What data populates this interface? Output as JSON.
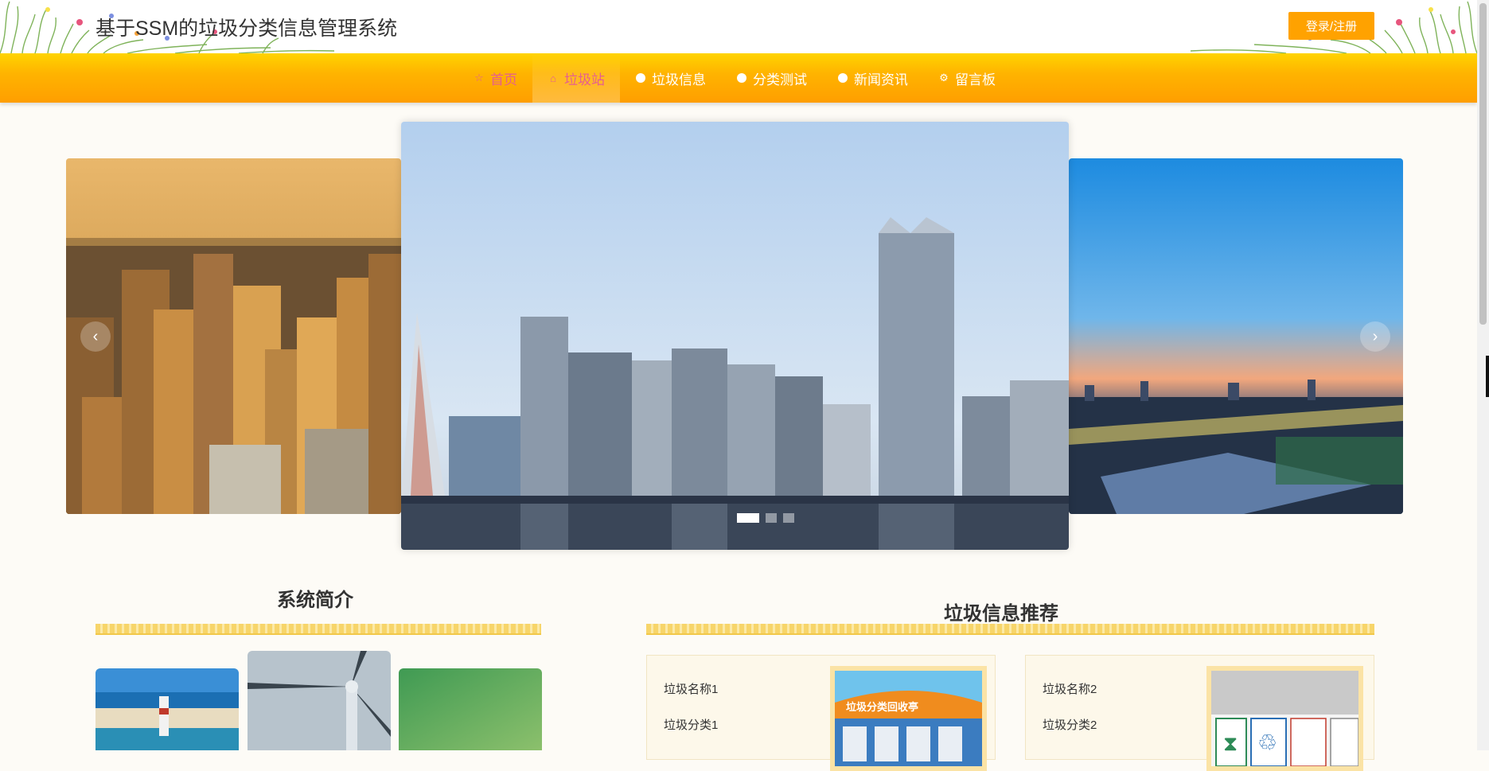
{
  "header": {
    "site_title": "基于SSM的垃圾分类信息管理系统",
    "login_label": "登录/注册"
  },
  "nav": {
    "items": [
      {
        "label": "首页",
        "icon": "star-icon"
      },
      {
        "label": "垃圾站",
        "icon": "home-icon"
      },
      {
        "label": "垃圾信息",
        "icon": "dot-icon"
      },
      {
        "label": "分类测试",
        "icon": "dot-icon"
      },
      {
        "label": "新闻资讯",
        "icon": "info-icon"
      },
      {
        "label": "留言板",
        "icon": "gear-icon"
      }
    ],
    "active_index": 1
  },
  "carousel": {
    "slide_count": 3,
    "active_index": 0
  },
  "intro": {
    "title": "系统简介"
  },
  "recommend": {
    "title": "垃圾信息推荐",
    "cards": [
      {
        "name": "垃圾名称1",
        "category": "垃圾分类1",
        "sign": "垃圾分类回收亭"
      },
      {
        "name": "垃圾名称2",
        "category": "垃圾分类2"
      }
    ]
  },
  "colors": {
    "accent": "#ffa200",
    "nav_active": "#e65f8f",
    "ribbon": "#f7d56a"
  }
}
